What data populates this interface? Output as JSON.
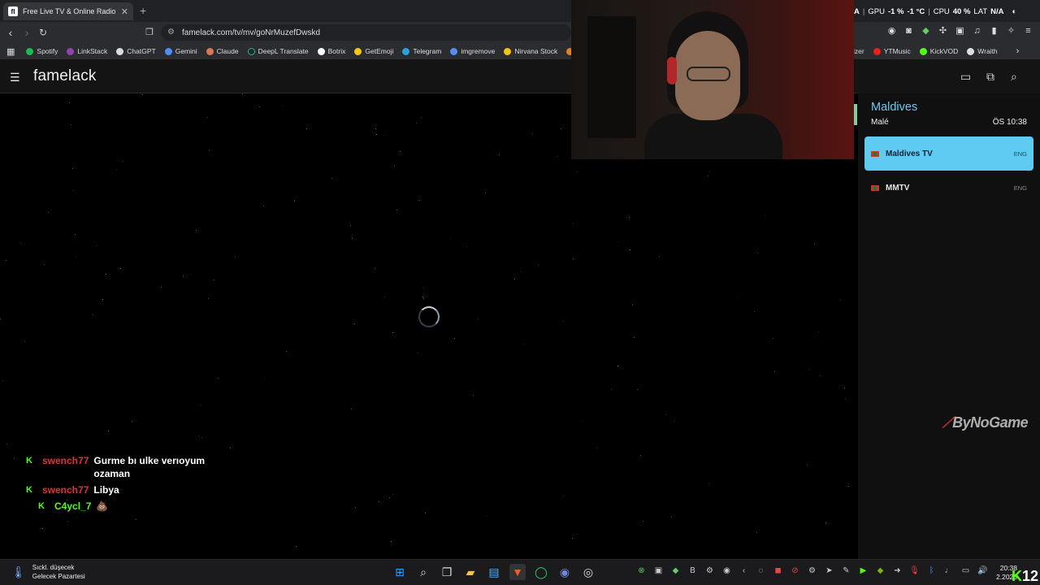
{
  "browser": {
    "tab_title": "Free Live TV & Online Radio",
    "tab_favicon": "fl",
    "new_tab_label": "+",
    "url": "famelack.com/tv/mv/goNrMuzefDwskd",
    "bookmarks": [
      {
        "label": "Spotify",
        "color": "#1db954"
      },
      {
        "label": "LinkStack",
        "color": "#8e44ad"
      },
      {
        "label": "ChatGPT",
        "color": "#dddddd"
      },
      {
        "label": "Gemini",
        "color": "#4f8ef7"
      },
      {
        "label": "Claude",
        "color": "#d97757"
      },
      {
        "label": "DeepL Translate",
        "color": "#0f2b46"
      },
      {
        "label": "Botrix",
        "color": "#ffffff"
      },
      {
        "label": "GetEmoji",
        "color": "#f5c518"
      },
      {
        "label": "Telegram",
        "color": "#2aa1da"
      },
      {
        "label": "imgremove",
        "color": "#5b8def"
      },
      {
        "label": "Nirvana Stock",
        "color": "#f1c40f"
      },
      {
        "label": "S",
        "color": "#e67e22"
      }
    ],
    "bookmarks_right": [
      {
        "label": "izer",
        "color": ""
      },
      {
        "label": "YTMusic",
        "color": "#e62117"
      },
      {
        "label": "KickVOD",
        "color": "#53fc18"
      },
      {
        "label": "Wraith",
        "color": "#dddddd"
      }
    ]
  },
  "app": {
    "brand": "famelack"
  },
  "overlay_stats": {
    "a_label": "A",
    "gpu_label": "GPU",
    "gpu_value": "-1 %",
    "gpu_temp": "-1 °C",
    "cpu_label": "CPU",
    "cpu_value": "40 %",
    "lat_label": "LAT",
    "lat_value": "N/A"
  },
  "panel": {
    "country": "Maldives",
    "city": "Malé",
    "local_time": "ÖS 10:38",
    "channels": [
      {
        "name": "Maldives TV",
        "lang": "ENG",
        "active": true
      },
      {
        "name": "MMTV",
        "lang": "ENG",
        "active": false
      }
    ]
  },
  "sponsor": {
    "logo_text": "ByNoGame"
  },
  "chat": {
    "platform_glyph": "K",
    "messages": [
      {
        "user": "swench77",
        "line1": "Gurme bı ulke verıoyum",
        "line2": "ozaman"
      },
      {
        "user": "swench77",
        "line1": "Libya",
        "line2": ""
      },
      {
        "user": "C4ycl_7",
        "line1": "💩",
        "line2": ""
      }
    ]
  },
  "taskbar": {
    "weather_line1": "Sıckl. düşecek",
    "weather_line2": "Gelecek Pazartesi",
    "time": "20:38",
    "date": "2.2025",
    "badge_number": "12"
  }
}
